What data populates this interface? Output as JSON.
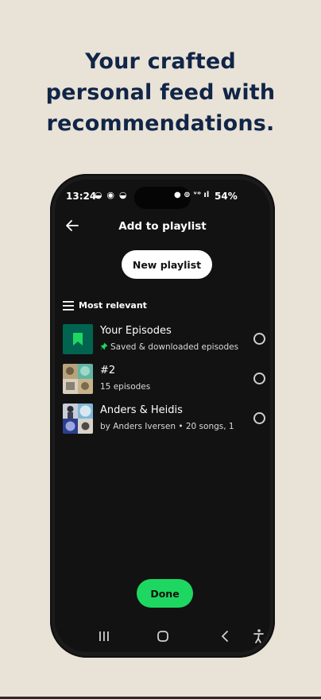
{
  "headline": {
    "line1": "Your crafted",
    "line2": "personal feed with",
    "line3": "recommendations."
  },
  "status_bar": {
    "time": "13:24",
    "app_icons": "◒ ◉ ◒",
    "sys_icons": "● ⊚ ᵛᵒ ıl",
    "battery": "54%"
  },
  "screen": {
    "title": "Add to playlist",
    "new_playlist_label": "New playlist",
    "sort_label": "Most relevant",
    "done_label": "Done"
  },
  "playlists": [
    {
      "name": "Your Episodes",
      "subtitle": "Saved & downloaded episodes",
      "pinned": true
    },
    {
      "name": "#2",
      "subtitle": "15 episodes",
      "pinned": false
    },
    {
      "name": "Anders & Heidis",
      "subtitle": "by Anders Iversen • 20 songs, 1",
      "pinned": false
    }
  ],
  "colors": {
    "background": "#e9e2d6",
    "headline": "#102547",
    "accent_green": "#1ed760",
    "your_episodes_tile": "#006450"
  },
  "icons": {
    "back": "arrow-left-icon",
    "sort": "list-icon",
    "pin": "pin-icon",
    "bookmark": "bookmark-icon",
    "nav_recent": "recent-apps-icon",
    "nav_home": "home-icon",
    "nav_back": "chevron-left-icon",
    "nav_accessibility": "accessibility-icon"
  }
}
